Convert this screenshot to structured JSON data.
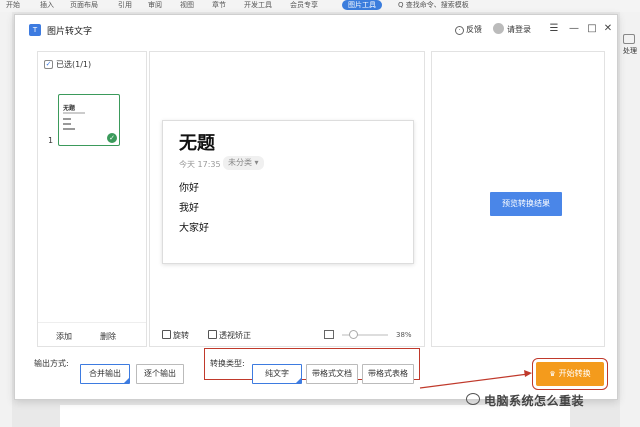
{
  "host": {
    "menu": [
      "开始",
      "插入",
      "页面布局",
      "引用",
      "审阅",
      "视图",
      "章节",
      "开发工具",
      "会员专享",
      "图片工具"
    ],
    "search_placeholder": "Q 查找命令、搜索模板",
    "side_label": "处理"
  },
  "dialog": {
    "app_icon_text": "T",
    "title": "图片转文字",
    "feedback": "反馈",
    "login": "请登录",
    "menu_glyph": "☰",
    "min_glyph": "—",
    "max_glyph": "□",
    "close_glyph": "✕"
  },
  "thumbnails": {
    "selected_label": "已选(1/1)",
    "check_glyph": "✓",
    "items": [
      {
        "index": "1",
        "title": "无题",
        "ok_glyph": "✓"
      }
    ],
    "add_label": "添加",
    "delete_label": "删除"
  },
  "preview": {
    "heading": "无题",
    "meta": "今天 17:35",
    "tag": "未分类 ▾",
    "lines": [
      "你好",
      "我好",
      "大家好"
    ],
    "rotate_label": "旋转",
    "perspective_label": "透视矫正",
    "zoom": "38%",
    "zoom_fraction": 0.38
  },
  "result": {
    "preview_button": "预览转换结果"
  },
  "bottom": {
    "output_label": "输出方式:",
    "output_options": [
      {
        "label": "合并输出",
        "selected": true
      },
      {
        "label": "逐个输出",
        "selected": false
      }
    ],
    "convert_label": "转换类型:",
    "convert_options": [
      {
        "label": "纯文字",
        "selected": true
      },
      {
        "label": "带格式文档",
        "selected": false
      },
      {
        "label": "带格式表格",
        "selected": false
      }
    ],
    "start_button": "开始转换",
    "start_icon": "♛"
  },
  "watermark": "电脑系统怎么重装",
  "colors": {
    "accent": "#3d7be0",
    "start": "#f49b1c",
    "highlight": "#c0392b",
    "ok": "#3b9a5b"
  }
}
